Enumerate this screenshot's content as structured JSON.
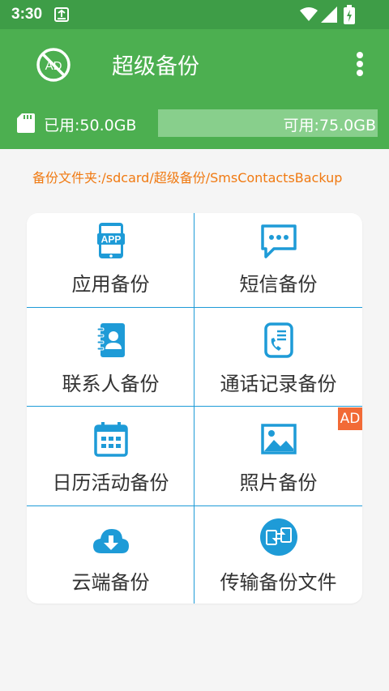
{
  "status_bar": {
    "time": "3:30"
  },
  "app_bar": {
    "title": "超级备份",
    "ad_icon_text": "AD"
  },
  "storage": {
    "used_label": "已用:50.0GB",
    "free_label": "可用:75.0GB",
    "used_fraction": 0.4
  },
  "backup_path": "备份文件夹:/sdcard/超级备份/SmsContactsBackup",
  "grid": {
    "items": [
      {
        "label": "应用备份",
        "icon": "app-icon"
      },
      {
        "label": "短信备份",
        "icon": "message-icon"
      },
      {
        "label": "联系人备份",
        "icon": "contacts-icon"
      },
      {
        "label": "通话记录备份",
        "icon": "call-log-icon"
      },
      {
        "label": "日历活动备份",
        "icon": "calendar-icon"
      },
      {
        "label": "照片备份",
        "icon": "photo-icon"
      },
      {
        "label": "云端备份",
        "icon": "cloud-download-icon"
      },
      {
        "label": "传输备份文件",
        "icon": "transfer-icon"
      }
    ],
    "ad_badge": "AD",
    "app_icon_text": "APP"
  },
  "colors": {
    "primary": "#4caf50",
    "status_bar": "#3e9d47",
    "accent_line": "#1e9bd7",
    "icon_blue": "#1e9bd7",
    "path_orange": "#f07a12",
    "ad_badge": "#f26a36"
  }
}
